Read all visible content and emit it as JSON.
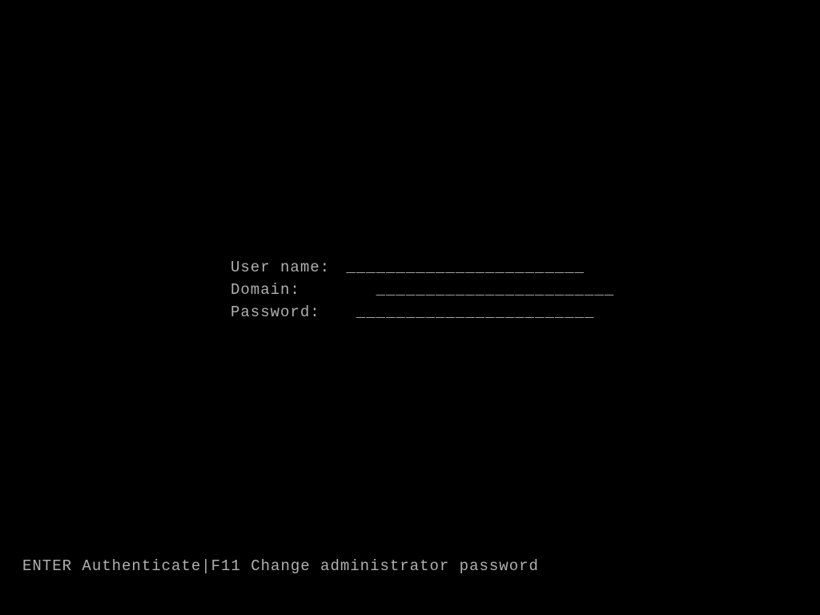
{
  "form": {
    "username_label": "User name:",
    "domain_label": "Domain:",
    "password_label": "Password:",
    "username_value": "",
    "domain_value": "",
    "password_value": "",
    "underline": "________________________"
  },
  "footer": {
    "text": "ENTER Authenticate|F11 Change administrator password"
  }
}
